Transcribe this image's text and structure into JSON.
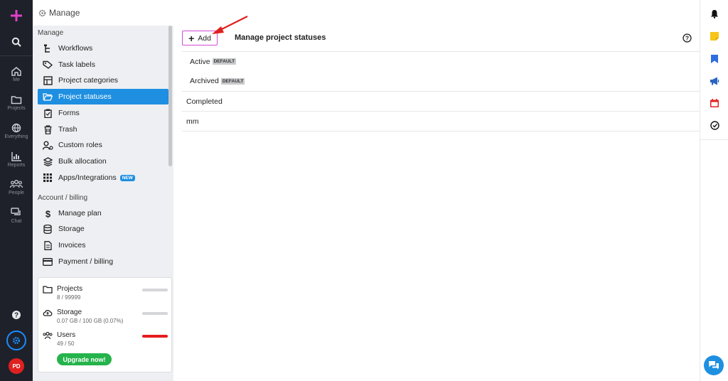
{
  "rail": {
    "items": [
      {
        "label": "Me",
        "icon": "home-icon"
      },
      {
        "label": "Projects",
        "icon": "folder-icon"
      },
      {
        "label": "Everything",
        "icon": "globe-icon"
      },
      {
        "label": "Reports",
        "icon": "chart-icon"
      },
      {
        "label": "People",
        "icon": "people-icon"
      },
      {
        "label": "Chat",
        "icon": "chat-icon"
      }
    ],
    "avatar_initials": "PD",
    "accent_color": "#e040c8"
  },
  "header": {
    "title": "Manage"
  },
  "sidebar": {
    "manage_heading": "Manage",
    "items": [
      {
        "label": "Workflows",
        "icon": "workflow-icon"
      },
      {
        "label": "Task labels",
        "icon": "tag-icon"
      },
      {
        "label": "Project categories",
        "icon": "grid-icon"
      },
      {
        "label": "Project statuses",
        "icon": "folder-open-icon"
      },
      {
        "label": "Forms",
        "icon": "clipboard-icon"
      },
      {
        "label": "Trash",
        "icon": "trash-icon"
      },
      {
        "label": "Custom roles",
        "icon": "user-role-icon"
      },
      {
        "label": "Bulk allocation",
        "icon": "layers-icon"
      },
      {
        "label": "Apps/Integrations",
        "icon": "apps-icon",
        "badge": "NEW"
      }
    ],
    "billing_heading": "Account / billing",
    "billing_items": [
      {
        "label": "Manage plan",
        "icon": "dollar-icon"
      },
      {
        "label": "Storage",
        "icon": "database-icon"
      },
      {
        "label": "Invoices",
        "icon": "invoice-icon"
      },
      {
        "label": "Payment / billing",
        "icon": "credit-card-icon"
      }
    ],
    "usage": {
      "projects": {
        "label": "Projects",
        "value": "8 / 99999"
      },
      "storage": {
        "label": "Storage",
        "value": "0.07 GB / 100 GB (0.07%)"
      },
      "users": {
        "label": "Users",
        "value": "49 / 50"
      },
      "upgrade_label": "Upgrade now!"
    }
  },
  "main": {
    "add_label": "Add",
    "title": "Manage project statuses",
    "statuses": [
      {
        "name": "Active",
        "badge": "DEFAULT"
      },
      {
        "name": "Archived",
        "badge": "DEFAULT"
      },
      {
        "name": "Completed",
        "badge": ""
      },
      {
        "name": "mm",
        "badge": ""
      }
    ]
  },
  "colors": {
    "active_item": "#1e8fe1",
    "upgrade_button": "#25b34b",
    "users_bar": "#e51c1c",
    "add_border": "#d14bd6",
    "annotation_arrow": "#e02020"
  }
}
